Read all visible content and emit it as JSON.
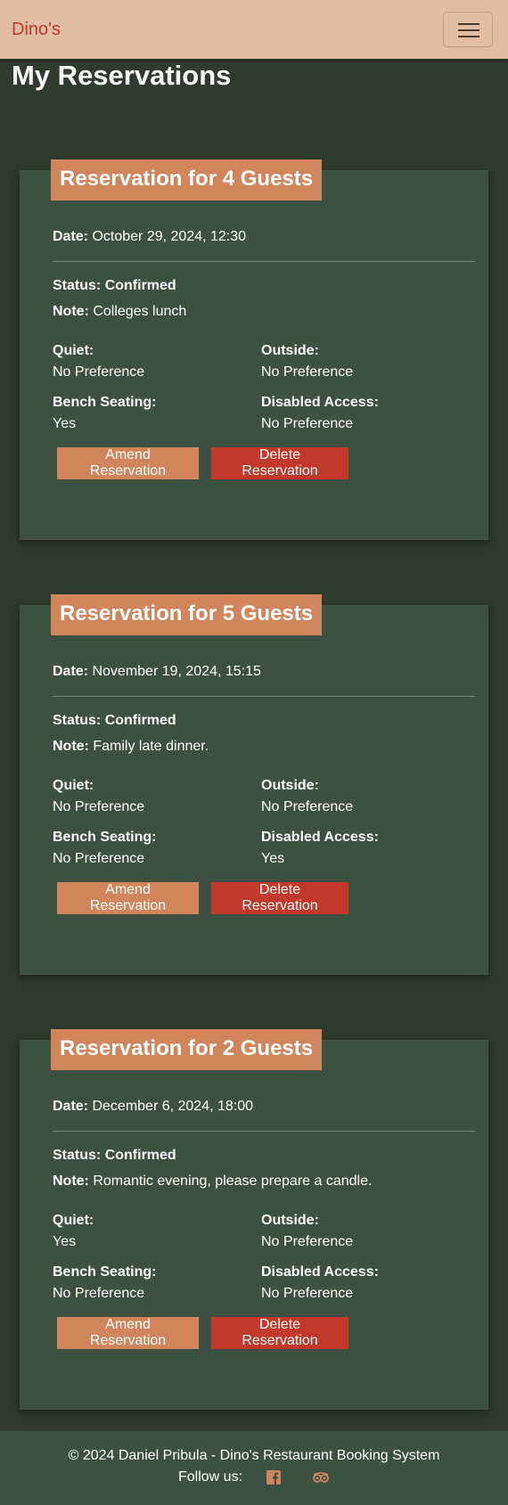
{
  "navbar": {
    "brand": "Dino's"
  },
  "page": {
    "title": "My Reservations"
  },
  "labels": {
    "date": "Date:",
    "status": "Status:",
    "note": "Note:",
    "quiet": "Quiet:",
    "outside": "Outside:",
    "bench": "Bench Seating:",
    "disabled": "Disabled Access:",
    "amend": "Amend Reservation",
    "delete": "Delete Reservation"
  },
  "reservations": [
    {
      "title": "Reservation for 4 Guests",
      "date": "October 29, 2024, 12:30",
      "status": "Confirmed",
      "note": "Colleges lunch",
      "quiet": "No Preference",
      "outside": "No Preference",
      "bench": "Yes",
      "disabled": "No Preference"
    },
    {
      "title": "Reservation for 5 Guests",
      "date": "November 19, 2024, 15:15",
      "status": "Confirmed",
      "note": "Family late dinner.",
      "quiet": "No Preference",
      "outside": "No Preference",
      "bench": "No Preference",
      "disabled": "Yes"
    },
    {
      "title": "Reservation for 2 Guests",
      "date": "December 6, 2024, 18:00",
      "status": "Confirmed",
      "note": "Romantic evening, please prepare a candle.",
      "quiet": "Yes",
      "outside": "No Preference",
      "bench": "No Preference",
      "disabled": "No Preference"
    }
  ],
  "footer": {
    "copyright": "© 2024 Daniel Pribula - Dino's Restaurant Booking System",
    "follow": "Follow us:",
    "icons": [
      "facebook-icon",
      "tripadvisor-icon"
    ]
  },
  "colors": {
    "background": "#2f3b2f",
    "card": "#3c5142",
    "navbar": "#e2bda3",
    "accent": "#d2855c",
    "danger": "#c0392b"
  }
}
